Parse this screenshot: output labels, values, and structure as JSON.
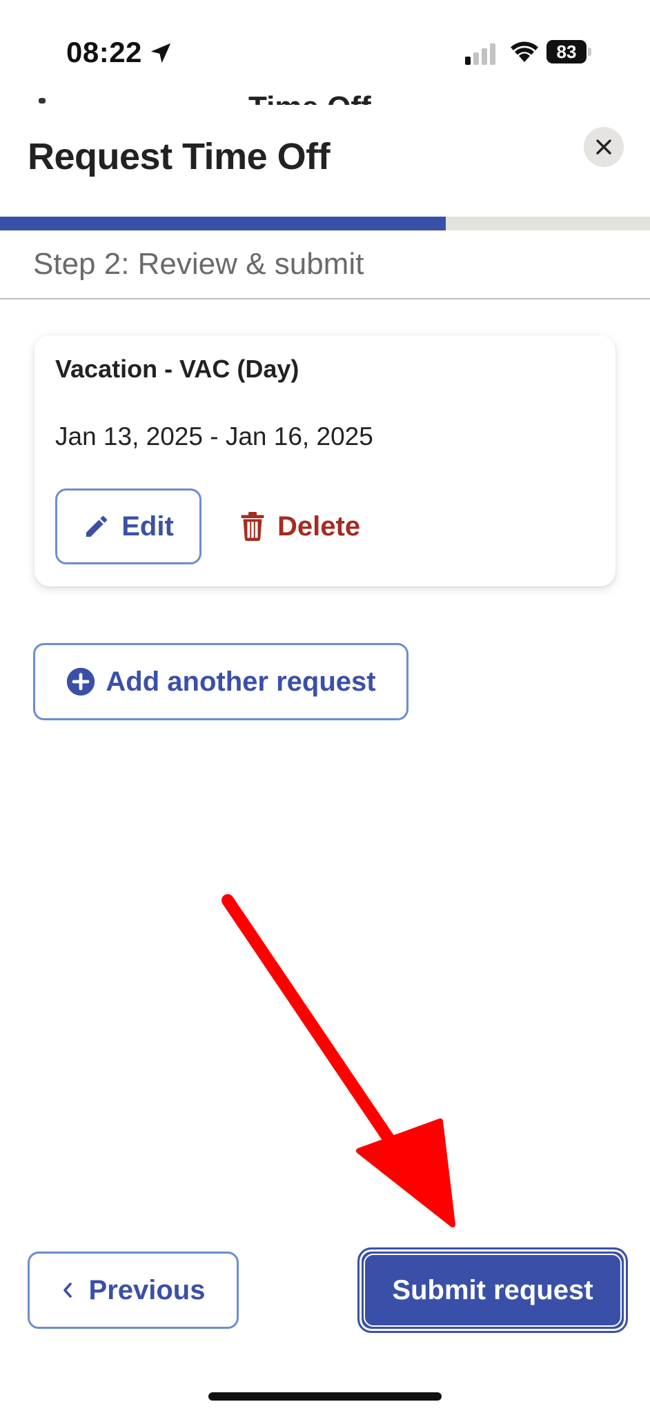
{
  "status_bar": {
    "time": "08:22",
    "battery_level": "83",
    "icons": [
      "location-arrow-icon",
      "cellular-signal-icon",
      "wifi-icon",
      "battery-icon"
    ]
  },
  "peek_title": "Time Off",
  "header": {
    "title": "Request Time Off",
    "close_icon": "close-icon"
  },
  "progress": {
    "fraction": 0.686,
    "fill_color": "#3a50a8",
    "track_color": "#e4e2df"
  },
  "step_label": "Step 2: Review & submit",
  "request_card": {
    "title": "Vacation - VAC (Day)",
    "dates": "Jan 13, 2025 - Jan 16, 2025",
    "edit_label": "Edit",
    "edit_icon": "pencil-icon",
    "delete_label": "Delete",
    "delete_icon": "trash-icon"
  },
  "add_request": {
    "label": "Add another request",
    "icon": "plus-circle-icon"
  },
  "footer": {
    "previous_label": "Previous",
    "previous_icon": "chevron-left-icon",
    "submit_label": "Submit request"
  },
  "colors": {
    "primary": "#3a50a8",
    "outline": "#6b8dd0",
    "danger": "#a32c22",
    "annotation_arrow": "#ff0000"
  }
}
